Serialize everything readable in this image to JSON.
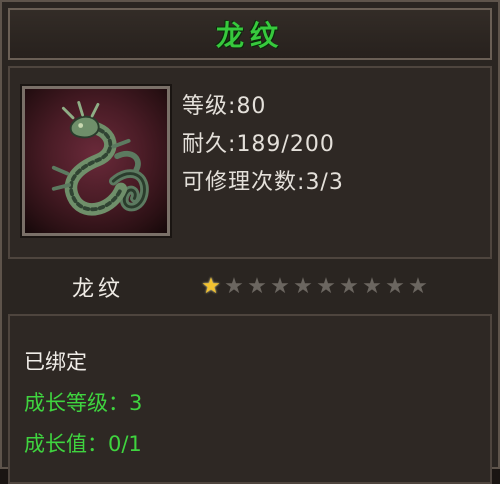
{
  "title": "龙纹",
  "item": {
    "icon": "dragon-emblem",
    "stats": [
      {
        "label": "等级",
        "value": "80"
      },
      {
        "label": "耐久",
        "value": "189/200"
      },
      {
        "label": "可修理次数",
        "value": "3/3"
      }
    ],
    "name": "龙纹",
    "stars": {
      "filled": 1,
      "total": 10
    },
    "bound_text": "已绑定",
    "growth_level_label": "成长等级：",
    "growth_level_value": "3",
    "growth_value_label": "成长值：",
    "growth_value_value": "0/1"
  },
  "colors": {
    "title_green": "#37c93d",
    "attr_green": "#3fd43f",
    "star_gold": "#f2c230",
    "star_gray": "#6b6660"
  }
}
